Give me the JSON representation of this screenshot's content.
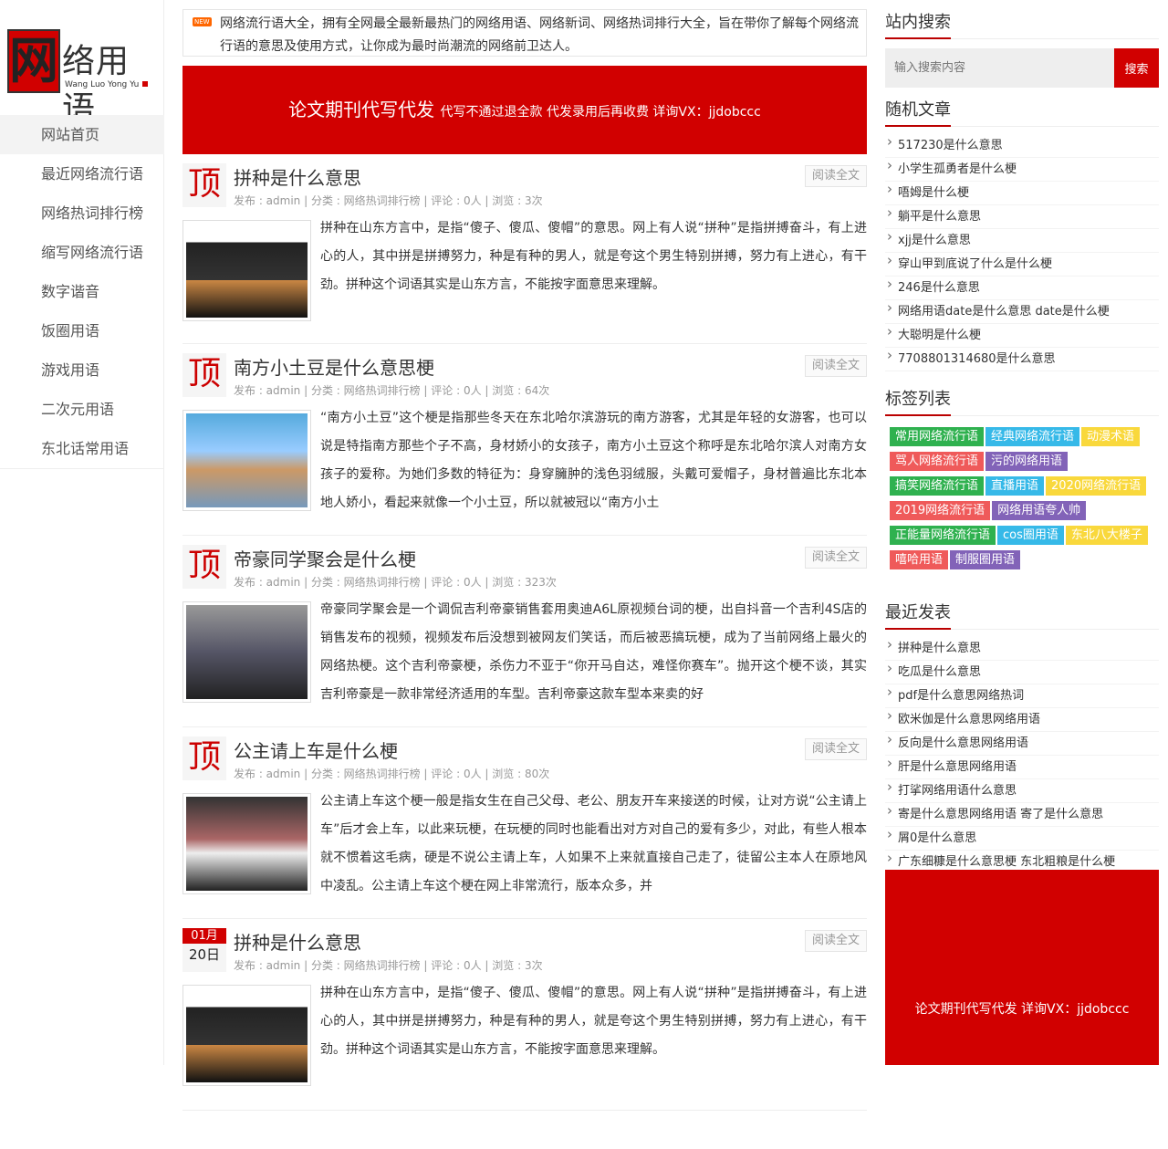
{
  "logo": {
    "main": "网络用语",
    "sub": "Wang Luo Yong Yu"
  },
  "nav": [
    "网站首页",
    "最近网络流行语",
    "网络热词排行榜",
    "缩写网络流行语",
    "数字谐音",
    "饭圈用语",
    "游戏用语",
    "二次元用语",
    "东北话常用语"
  ],
  "notice": {
    "badge": "NEW",
    "text": "网络流行语大全，拥有全网最全最新最热门的网络用语、网络新词、网络热词排行大全，旨在带你了解每个网络流行语的意思及使用方式，让你成为最时尚潮流的网络前卫达人。"
  },
  "ad": {
    "big": "论文期刊代写代发",
    "small": "代写不通过退全款 代发录用后再收费 详询VX：jjdobccc"
  },
  "posts": [
    {
      "badge": "顶",
      "title": "拼种是什么意思",
      "meta": "发布 : admin | 分类 : 网络热词排行榜 | 评论 : 0人 | 浏览 : 3次",
      "more": "阅读全文",
      "excerpt": "拼种在山东方言中，是指“傻子、傻瓜、傻帽”的意思。网上有人说“拼种”是指拼搏奋斗，有上进心的人，其中拼是拼搏努力，种是有种的男人，就是夸这个男生特别拼搏，努力有上进心，有干劲。拼种这个词语其实是山东方言，不能按字面意思来理解。"
    },
    {
      "badge": "顶",
      "title": "南方小土豆是什么意思梗",
      "meta": "发布 : admin | 分类 : 网络热词排行榜 | 评论 : 0人 | 浏览 : 64次",
      "more": "阅读全文",
      "excerpt": "“南方小土豆”这个梗是指那些冬天在东北哈尔滨游玩的南方游客，尤其是年轻的女游客，也可以说是特指南方那些个子不高，身材娇小的女孩子，南方小土豆这个称呼是东北哈尔滨人对南方女孩子的爱称。为她们多数的特征为：身穿臃肿的浅色羽绒服，头戴可爱帽子，身材普遍比东北本地人娇小，看起来就像一个小土豆，所以就被冠以“南方小土"
    },
    {
      "badge": "顶",
      "title": "帝豪同学聚会是什么梗",
      "meta": "发布 : admin | 分类 : 网络热词排行榜 | 评论 : 0人 | 浏览 : 323次",
      "more": "阅读全文",
      "excerpt": "帝豪同学聚会是一个调侃吉利帝豪销售套用奥迪A6L原视频台词的梗，出自抖音一个吉利4S店的销售发布的视频，视频发布后没想到被网友们笑话，而后被恶搞玩梗，成为了当前网络上最火的网络热梗。这个吉利帝豪梗，杀伤力不亚于“你开马自达，难怪你赛车”。抛开这个梗不谈，其实吉利帝豪是一款非常经济适用的车型。吉利帝豪这款车型本来卖的好"
    },
    {
      "badge": "顶",
      "title": "公主请上车是什么梗",
      "meta": "发布 : admin | 分类 : 网络热词排行榜 | 评论 : 0人 | 浏览 : 80次",
      "more": "阅读全文",
      "excerpt": "公主请上车这个梗一般是指女生在自己父母、老公、朋友开车来接送的时候，让对方说“公主请上车”后才会上车，以此来玩梗，在玩梗的同时也能看出对方对自己的爱有多少，对此，有些人根本就不惯着这毛病，硬是不说公主请上车，人如果不上来就直接自己走了，徒留公主本人在原地风中凌乱。公主请上车这个梗在网上非常流行，版本众多，并"
    },
    {
      "month": "01月",
      "day": "20日",
      "title": "拼种是什么意思",
      "meta": "发布 : admin | 分类 : 网络热词排行榜 | 评论 : 0人 | 浏览 : 3次",
      "more": "阅读全文",
      "excerpt": "拼种在山东方言中，是指“傻子、傻瓜、傻帽”的意思。网上有人说“拼种”是指拼搏奋斗，有上进心的人，其中拼是拼搏努力，种是有种的男人，就是夸这个男生特别拼搏，努力有上进心，有干劲。拼种这个词语其实是山东方言，不能按字面意思来理解。"
    }
  ],
  "search": {
    "title": "站内搜索",
    "placeholder": "输入搜索内容",
    "button": "搜索"
  },
  "random": {
    "title": "随机文章",
    "items": [
      "517230是什么意思",
      "小学生孤勇者是什么梗",
      "唔姆是什么梗",
      "躺平是什么意思",
      "xjj是什么意思",
      "穿山甲到底说了什么是什么梗",
      "246是什么意思",
      "网络用语date是什么意思 date是什么梗",
      "大聪明是什么梗",
      "7708801314680是什么意思"
    ]
  },
  "tags": {
    "title": "标签列表",
    "items": [
      {
        "label": "常用网络流行语",
        "color": "#2fb14f"
      },
      {
        "label": "经典网络流行语",
        "color": "#36b9e8"
      },
      {
        "label": "动漫术语",
        "color": "#f9d83c"
      },
      {
        "label": "骂人网络流行语",
        "color": "#ef5a5a"
      },
      {
        "label": "污的网络用语",
        "color": "#8263b8"
      },
      {
        "label": "搞笑网络流行语",
        "color": "#2fb14f"
      },
      {
        "label": "直播用语",
        "color": "#36b9e8"
      },
      {
        "label": "2020网络流行语",
        "color": "#f9d83c"
      },
      {
        "label": "2019网络流行语",
        "color": "#ef5a5a"
      },
      {
        "label": "网络用语夸人帅",
        "color": "#8263b8"
      },
      {
        "label": "正能量网络流行语",
        "color": "#2fb14f"
      },
      {
        "label": "cos圈用语",
        "color": "#36b9e8"
      },
      {
        "label": "东北八大楼子",
        "color": "#f9d83c"
      },
      {
        "label": "嘻哈用语",
        "color": "#ef5a5a"
      },
      {
        "label": "制服圈用语",
        "color": "#8263b8"
      }
    ]
  },
  "recent": {
    "title": "最近发表",
    "items": [
      "拼种是什么意思",
      "吃瓜是什么意思",
      "pdf是什么意思网络热词",
      "欧米伽是什么意思网络用语",
      "反向是什么意思网络用语",
      "肝是什么意思网络用语",
      "打挲网络用语什么意思",
      "寄是什么意思网络用语 寄了是什么意思",
      "屑0是什么意思",
      "广东细糠是什么意思梗 东北粗粮是什么梗"
    ]
  },
  "sidead": "论文期刊代写代发 详询VX：jjdobccc"
}
